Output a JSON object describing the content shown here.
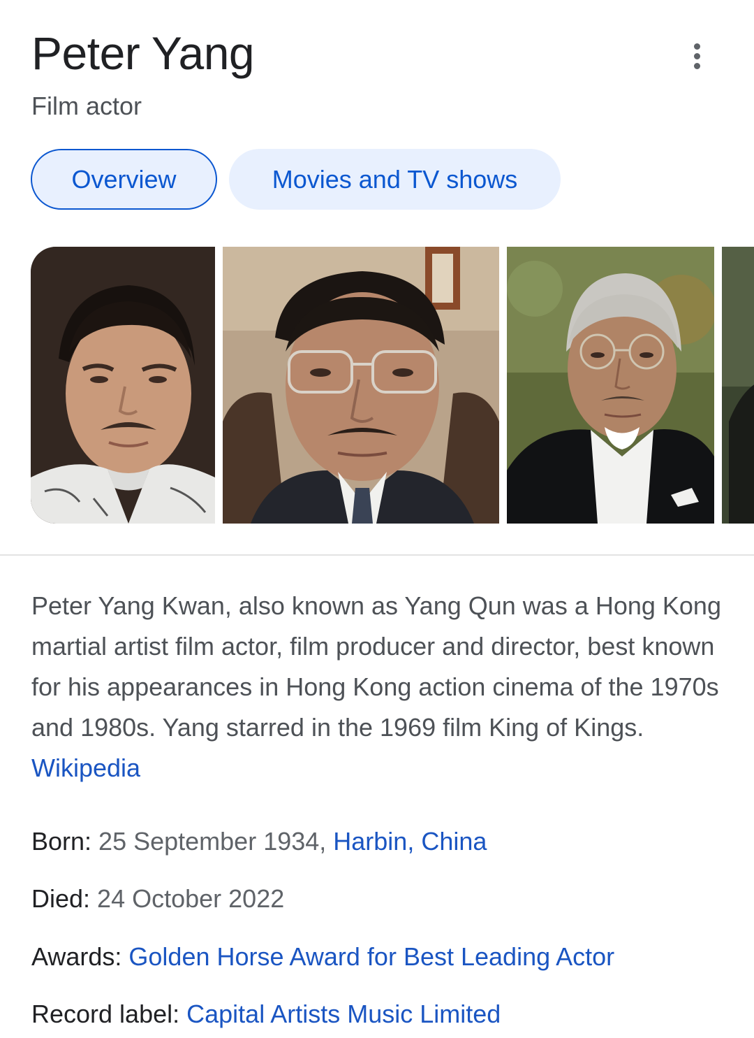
{
  "header": {
    "title": "Peter Yang",
    "subtitle": "Film actor",
    "more_icon": "more-vert-icon"
  },
  "tabs": [
    {
      "label": "Overview",
      "active": true
    },
    {
      "label": "Movies and TV shows",
      "active": false
    }
  ],
  "description": {
    "text": "Peter Yang Kwan, also known as Yang Qun was a Hong Kong martial artist film actor, film producer and director, best known for his appearances in Hong Kong action cinema of the 1970s and 1980s. Yang starred in the 1969 film King of Kings. ",
    "source": "Wikipedia"
  },
  "facts": {
    "born": {
      "label": "Born: ",
      "value": "25 September 1934, ",
      "link": "Harbin, China"
    },
    "died": {
      "label": "Died: ",
      "value": "24 October 2022"
    },
    "awards": {
      "label": "Awards: ",
      "link": "Golden Horse Award for Best Leading Actor"
    },
    "record_label": {
      "label": "Record label: ",
      "link": "Capital Artists Music Limited"
    }
  },
  "colors": {
    "accent": "#0b57d0",
    "link": "#1a55c2",
    "chip_bg": "#e8f0fe"
  }
}
